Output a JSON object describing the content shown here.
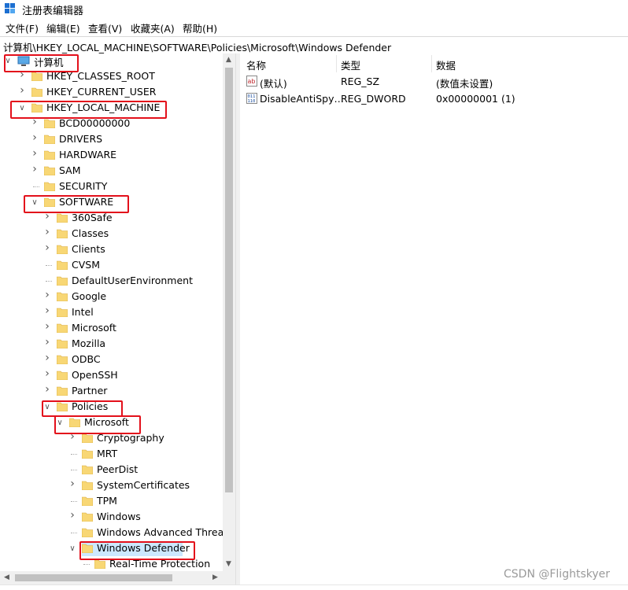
{
  "window": {
    "title": "注册表编辑器",
    "app_icon": "regedit-icon"
  },
  "menu": {
    "items": [
      {
        "label": "文件(F)"
      },
      {
        "label": "编辑(E)"
      },
      {
        "label": "查看(V)"
      },
      {
        "label": "收藏夹(A)"
      },
      {
        "label": "帮助(H)"
      }
    ]
  },
  "address": {
    "path": "计算机\\HKEY_LOCAL_MACHINE\\SOFTWARE\\Policies\\Microsoft\\Windows Defender"
  },
  "tree": {
    "root": "计算机",
    "nodes": [
      {
        "label": "HKEY_CLASSES_ROOT"
      },
      {
        "label": "HKEY_CURRENT_USER"
      },
      {
        "label": "HKEY_LOCAL_MACHINE"
      },
      {
        "label": "BCD00000000"
      },
      {
        "label": "DRIVERS"
      },
      {
        "label": "HARDWARE"
      },
      {
        "label": "SAM"
      },
      {
        "label": "SECURITY"
      },
      {
        "label": "SOFTWARE"
      },
      {
        "label": "360Safe"
      },
      {
        "label": "Classes"
      },
      {
        "label": "Clients"
      },
      {
        "label": "CVSM"
      },
      {
        "label": "DefaultUserEnvironment"
      },
      {
        "label": "Google"
      },
      {
        "label": "Intel"
      },
      {
        "label": "Microsoft"
      },
      {
        "label": "Mozilla"
      },
      {
        "label": "ODBC"
      },
      {
        "label": "OpenSSH"
      },
      {
        "label": "Partner"
      },
      {
        "label": "Policies"
      },
      {
        "label": "Microsoft"
      },
      {
        "label": "Cryptography"
      },
      {
        "label": "MRT"
      },
      {
        "label": "PeerDist"
      },
      {
        "label": "SystemCertificates"
      },
      {
        "label": "TPM"
      },
      {
        "label": "Windows"
      },
      {
        "label": "Windows Advanced Threat"
      },
      {
        "label": "Windows Defender"
      },
      {
        "label": "Real-Time Protection"
      }
    ]
  },
  "values": {
    "columns": {
      "name": "名称",
      "type": "类型",
      "data": "数据"
    },
    "rows": [
      {
        "name": "(默认)",
        "type": "REG_SZ",
        "data": "(数值未设置)",
        "icon": "string-value-icon"
      },
      {
        "name": "DisableAntiSpy…",
        "type": "REG_DWORD",
        "data": "0x00000001 (1)",
        "icon": "binary-value-icon"
      }
    ]
  },
  "watermark": "CSDN @Flightskyer",
  "colors": {
    "highlight": "#e3101b",
    "selection": "#cce8ff",
    "folder": "#f8d775"
  }
}
